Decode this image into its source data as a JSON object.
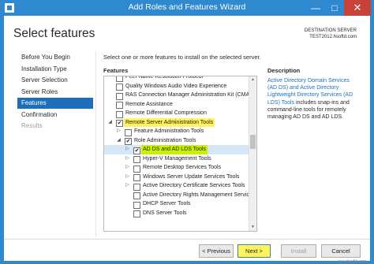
{
  "window": {
    "title": "Add Roles and Features Wizard",
    "minimize_glyph": "—",
    "maximize_glyph": "□",
    "close_glyph": "✕"
  },
  "header": {
    "page_title": "Select features",
    "destination_label": "DESTINATION SERVER",
    "destination_server": "TEST2012.hsoftd.com"
  },
  "nav": {
    "items": [
      {
        "label": "Before You Begin",
        "state": "normal"
      },
      {
        "label": "Installation Type",
        "state": "normal"
      },
      {
        "label": "Server Selection",
        "state": "normal"
      },
      {
        "label": "Server Roles",
        "state": "normal"
      },
      {
        "label": "Features",
        "state": "active"
      },
      {
        "label": "Confirmation",
        "state": "normal"
      },
      {
        "label": "Results",
        "state": "disabled"
      }
    ]
  },
  "main": {
    "intro": "Select one or more features to install on the selected server.",
    "features_label": "Features",
    "description_label": "Description"
  },
  "tree": {
    "rows": [
      {
        "label": "Peer Name Resolution Protocol",
        "checked": false,
        "level": 0,
        "expander": "none"
      },
      {
        "label": "Quality Windows Audio Video Experience",
        "checked": false,
        "level": 0,
        "expander": "none"
      },
      {
        "label": "RAS Connection Manager Administration Kit (CMA",
        "checked": false,
        "level": 0,
        "expander": "none"
      },
      {
        "label": "Remote Assistance",
        "checked": false,
        "level": 0,
        "expander": "none"
      },
      {
        "label": "Remote Differential Compression",
        "checked": false,
        "level": 0,
        "expander": "none"
      },
      {
        "label": "Remote Server Administration Tools",
        "checked": true,
        "level": 0,
        "expander": "open",
        "highlight": true
      },
      {
        "label": "Feature Administration Tools",
        "checked": false,
        "level": 1,
        "expander": "closed"
      },
      {
        "label": "Role Administration Tools",
        "checked": true,
        "level": 1,
        "expander": "open"
      },
      {
        "label": "AD DS and AD LDS Tools",
        "checked": true,
        "level": 2,
        "expander": "closed",
        "highlight": true,
        "selected": true
      },
      {
        "label": "Hyper-V Management Tools",
        "checked": false,
        "level": 2,
        "expander": "closed"
      },
      {
        "label": "Remote Desktop Services Tools",
        "checked": false,
        "level": 2,
        "expander": "closed"
      },
      {
        "label": "Windows Server Update Services Tools",
        "checked": false,
        "level": 2,
        "expander": "closed"
      },
      {
        "label": "Active Directory Certificate Services Tools",
        "checked": false,
        "level": 2,
        "expander": "closed"
      },
      {
        "label": "Active Directory Rights Management Servic",
        "checked": false,
        "level": 2,
        "expander": "none"
      },
      {
        "label": "DHCP Server Tools",
        "checked": false,
        "level": 2,
        "expander": "none"
      },
      {
        "label": "DNS Server Tools",
        "checked": false,
        "level": 2,
        "expander": "none"
      }
    ]
  },
  "description": {
    "link_text": "Active Directory Domain Services (AD DS) and Active Directory Lightweight Directory Services (AD LDS) Tools",
    "rest_text": " includes snap-ins and command-line tools for remotely managing AD DS and AD LDS."
  },
  "buttons": {
    "previous": "< Previous",
    "next": "Next >",
    "install": "Install",
    "cancel": "Cancel"
  },
  "watermark": "www.hsoftd.com",
  "colors": {
    "titlebar": "#2e89ce",
    "nav_active": "#1e6fb8",
    "highlight": "#fff45a",
    "selected_highlight": "#c9f200",
    "link": "#1e6fb8"
  },
  "icons": {
    "expander_open": "◢",
    "expander_closed": "▷",
    "checkmark": "✔",
    "scroll_up": "▲",
    "scroll_down": "▼"
  }
}
